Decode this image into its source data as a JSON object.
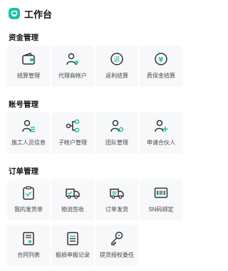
{
  "header": {
    "title": "工作台"
  },
  "sections": [
    {
      "title": "资金管理",
      "items": [
        {
          "label": "结算管理",
          "icon": "wallet-icon"
        },
        {
          "label": "代理商帐户",
          "icon": "agent-yen-icon"
        },
        {
          "label": "返利结算",
          "icon": "rebate-icon"
        },
        {
          "label": "质保金结算",
          "icon": "yen-circle-icon"
        }
      ]
    },
    {
      "title": "账号管理",
      "items": [
        {
          "label": "施工人员信息",
          "icon": "user-list-icon"
        },
        {
          "label": "子帐户管理",
          "icon": "sub-account-icon"
        },
        {
          "label": "团队管理",
          "icon": "team-icon"
        },
        {
          "label": "申请合伙人",
          "icon": "user-add-icon"
        }
      ]
    },
    {
      "title": "订单管理",
      "items": [
        {
          "label": "我的发货单",
          "icon": "clipboard-check-icon"
        },
        {
          "label": "物流签收",
          "icon": "truck-check-icon"
        },
        {
          "label": "订单发货",
          "icon": "truck-list-icon"
        },
        {
          "label": "SN码绑定",
          "icon": "barcode-icon"
        },
        {
          "label": "合同列表",
          "icon": "contract-star-icon"
        },
        {
          "label": "报损申报记录",
          "icon": "report-list-icon"
        },
        {
          "label": "提货授权委任",
          "icon": "key-icon"
        }
      ]
    }
  ],
  "colors": {
    "accent": "#1fc1a6",
    "icon": "#333333",
    "tile": "#f7f8fa"
  }
}
